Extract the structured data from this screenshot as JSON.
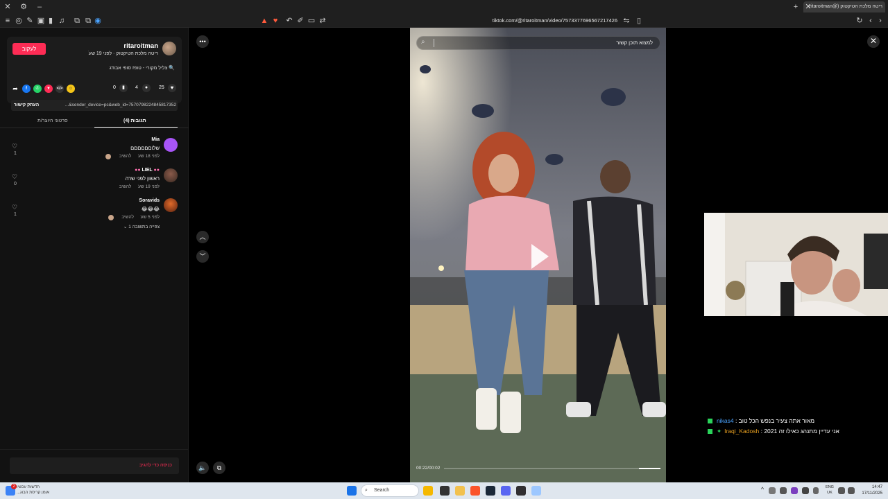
{
  "browser": {
    "tab_title": "ריטה מלכת הטיקטוק (@ritaroitman",
    "url": "tiktok.com/@ritaroitman/video/7573377696567217426",
    "new_tab_icon": "plus-icon",
    "close_tab_icon": "close-icon"
  },
  "author": {
    "follow_label": "לעקוב",
    "username": "ritaroitman",
    "subtitle": "ריטה מלכת הטיקטוק · לפני 19 שעׁ",
    "music": "צליל מקורי - טופז סופי אבודג"
  },
  "stats": {
    "likes": "25",
    "comments": "4",
    "saves": "0"
  },
  "share": {
    "link_text": "...&sender_device=pc&web_id=7570798224845817352",
    "copy_label": "העתק קישור"
  },
  "tabs": {
    "comments_label": "תגובות (4)",
    "creator_videos_label": "סרטוני היוצר/ת"
  },
  "comments": [
    {
      "name": "Mia",
      "text": "שלוםםםםםם",
      "time": "לפני 18 שעׁ",
      "reply": "להשיב",
      "likes": "1",
      "avatar_color": "#a855f7"
    },
    {
      "name": "LIEL",
      "text": "ראשון לפני שרה",
      "time": "לפני 19 שעׁ",
      "reply": "להשיב",
      "likes": "0",
      "avatar_color": "#6b3b2e"
    },
    {
      "name": "Soravids",
      "text": "😂😂😂",
      "time": "לפני 5 שעׁ",
      "reply": "להשיב",
      "likes": "1",
      "avatar_color": "#b94a1a",
      "view_replies": "צפייה בתשובה 1"
    }
  ],
  "comment_input_placeholder": "כניסה כדי להגיב",
  "video": {
    "search_placeholder": "למצוא תוכן קשור",
    "time_code": "00:22/00:02",
    "progress": 0.1
  },
  "chat": [
    {
      "user": "nikas4",
      "user_color": "#4aa3ff",
      "message": "מאור אתה צעיר בנפש הכל טוב"
    },
    {
      "user": "Iraqi_Kadosh",
      "user_color": "#e8a020",
      "message": "אני עדיין מתנהג כאילו זה 2021"
    }
  ],
  "taskbar": {
    "weather_line1": "חדשות עכשיו",
    "weather_line2": "אומן קריסת הבוג...",
    "search_label": "Search",
    "lang_line1": "ENG",
    "lang_line2": "UK",
    "time": "14:47",
    "date": "17/11/2025",
    "notification_count": "2"
  },
  "colors": {
    "accent": "#fe2c55",
    "chat_check": "#2ad35a"
  }
}
